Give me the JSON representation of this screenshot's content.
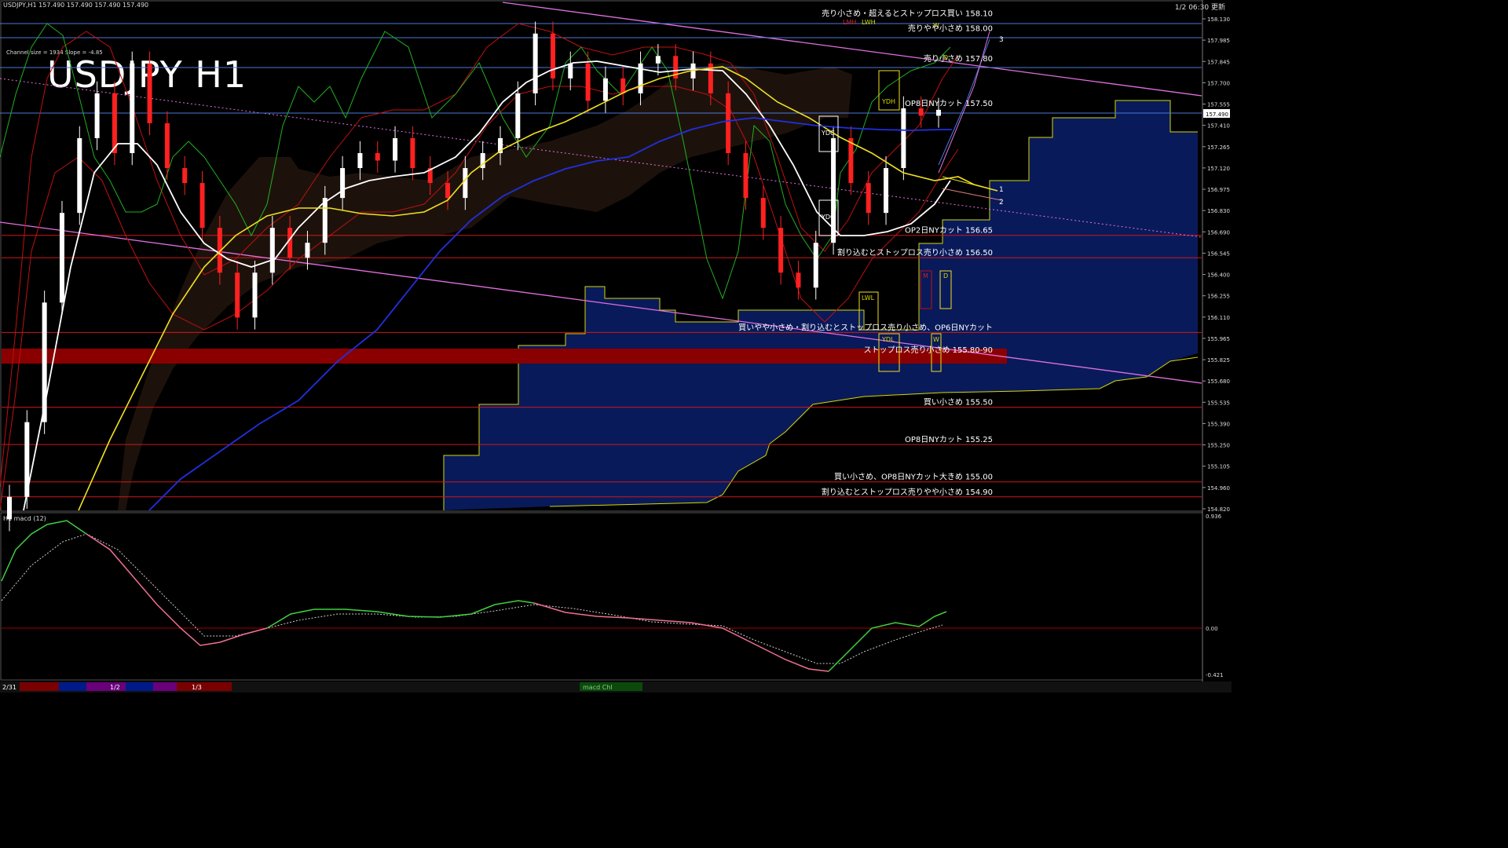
{
  "header": {
    "symbol_info": "USDJPY,H1  157.490 157.490 157.490 157.490",
    "datetime": "1/2 06:30 更新"
  },
  "title": "USDJPY H1",
  "channel_info": "Channel size = 1934 Slope = -4.85",
  "macd_label": "H1  macd (12)",
  "macd_tab": "macd Chl",
  "colors": {
    "background": "#000000",
    "bull": "#ffffff",
    "bear": "#ff2020",
    "level_line": "#d01818",
    "blue_line": "#4a78d8",
    "channel": "#e070e0",
    "sma_yellow": "#f0e020",
    "sma_white": "#ffffff",
    "sma_blue": "#2030e0",
    "cloud_edge": "#e0e000",
    "macd_up": "#40d040",
    "macd_down": "#f07090"
  },
  "chart_data": {
    "type": "line",
    "symbol": "USDJPY",
    "timeframe": "H1",
    "current_price": "157.490",
    "ylim": [
      154.82,
      158.13
    ],
    "y_ticks": [
      "158.130",
      "157.985",
      "157.845",
      "157.700",
      "157.555",
      "157.410",
      "157.265",
      "157.120",
      "156.975",
      "156.830",
      "156.690",
      "156.545",
      "156.400",
      "156.255",
      "156.110",
      "155.965",
      "155.825",
      "155.680",
      "155.535",
      "155.390",
      "155.250",
      "155.105",
      "154.960",
      "154.820"
    ],
    "order_levels": [
      {
        "price": 158.1,
        "label": "売り小さめ・超えるとストップロス買い 158.10"
      },
      {
        "price": 158.0,
        "label": "売りやや小さめ 158.00"
      },
      {
        "price": 157.8,
        "label": "売り小さめ 157.80"
      },
      {
        "price": 157.5,
        "label": "OP8日NYカット 157.50"
      },
      {
        "price": 156.65,
        "label": "OP2日NYカット 156.65"
      },
      {
        "price": 156.5,
        "label": "割り込むとストップロス売り小さめ 156.50"
      },
      {
        "price": 156.0,
        "label": "買いやや小さめ・割り込むとストップロス売り小さめ、OP6日NYカット"
      },
      {
        "price": 155.85,
        "label": "ストップロス売り小さめ 155.80-90"
      },
      {
        "price": 155.5,
        "label": "買い小さめ 155.50"
      },
      {
        "price": 155.25,
        "label": "OP8日NYカット 155.25"
      },
      {
        "price": 155.0,
        "label": "買い小さめ、OP8日NYカット大きめ 155.00"
      },
      {
        "price": 154.9,
        "label": "割り込むとストップロス売りやや小さめ 154.90"
      }
    ],
    "box_labels": [
      "LMH",
      "LWH",
      "YDH",
      "YDC",
      "YDO",
      "LWL",
      "YDL",
      "W",
      "D",
      "M",
      "D",
      "W"
    ],
    "projection_labels": [
      "1",
      "2",
      "3"
    ],
    "candles_close": [
      154.9,
      155.4,
      156.2,
      156.8,
      157.3,
      157.6,
      157.2,
      157.8,
      157.4,
      157.1,
      157.0,
      156.7,
      156.4,
      156.1,
      156.4,
      156.7,
      156.5,
      156.6,
      156.9,
      157.1,
      157.2,
      157.15,
      157.3,
      157.1,
      157.0,
      156.9,
      157.1,
      157.2,
      157.3,
      157.6,
      158.0,
      157.7,
      157.8,
      157.55,
      157.7,
      157.6,
      157.8,
      157.85,
      157.7,
      157.8,
      157.6,
      157.2,
      156.9,
      156.7,
      156.4,
      156.3,
      156.6,
      157.3,
      157.0,
      156.8,
      157.1,
      157.5,
      157.45,
      157.49
    ],
    "macd": [
      0.4,
      0.55,
      0.5,
      0.3,
      0.1,
      -0.1,
      -0.05,
      0.0,
      0.05,
      0.08,
      0.08,
      0.06,
      0.1,
      0.04,
      0.02,
      -0.02,
      -0.06,
      -0.18,
      -0.32,
      -0.4,
      -0.2,
      0.02,
      0.12
    ],
    "macd_ylim": [
      -0.421,
      0.936
    ],
    "macd_ticks": [
      "0.936",
      "0.00",
      "-0.421"
    ],
    "x_labels": [
      "2/31",
      "1/2",
      "1/3"
    ],
    "legend": "none",
    "grid": false
  }
}
